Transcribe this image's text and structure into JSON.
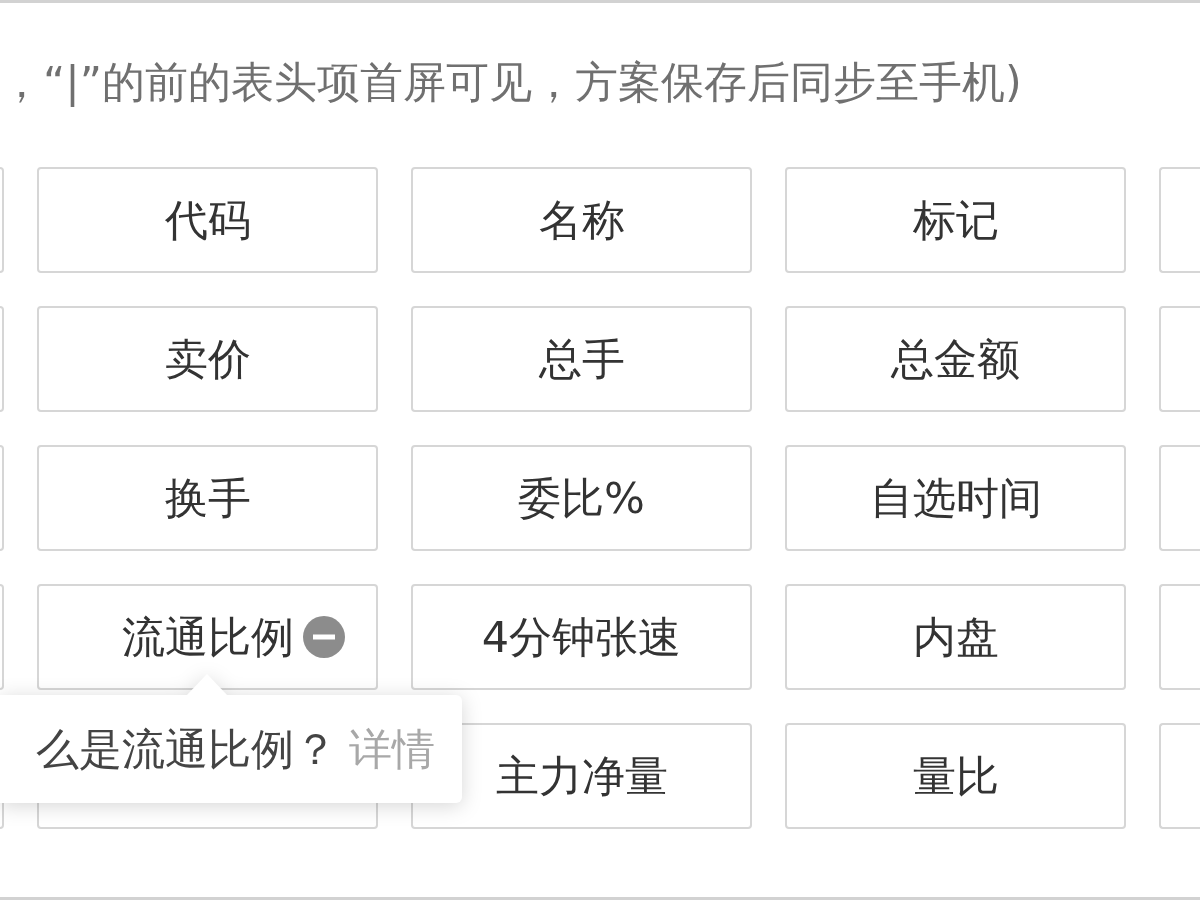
{
  "column_settings": {
    "hint": "，“|”的前的表头项首屏可见，方案保存后同步至手机)",
    "options": [
      {
        "label": "代码",
        "hovered": false
      },
      {
        "label": "名称",
        "hovered": false
      },
      {
        "label": "标记",
        "hovered": false
      },
      {
        "label": "卖价",
        "hovered": false
      },
      {
        "label": "总手",
        "hovered": false
      },
      {
        "label": "总金额",
        "hovered": false
      },
      {
        "label": "换手",
        "hovered": false
      },
      {
        "label": "委比%",
        "hovered": false
      },
      {
        "label": "自选时间",
        "hovered": false
      },
      {
        "label": "流通比例",
        "hovered": true
      },
      {
        "label": "4分钟张速",
        "hovered": false
      },
      {
        "label": "内盘",
        "hovered": false
      },
      {
        "hovered": false
      },
      {
        "label": "主力净量",
        "hovered": false
      },
      {
        "label": "量比",
        "hovered": false
      }
    ],
    "tooltip": {
      "text": "么是流通比例？",
      "link": "详情"
    }
  }
}
